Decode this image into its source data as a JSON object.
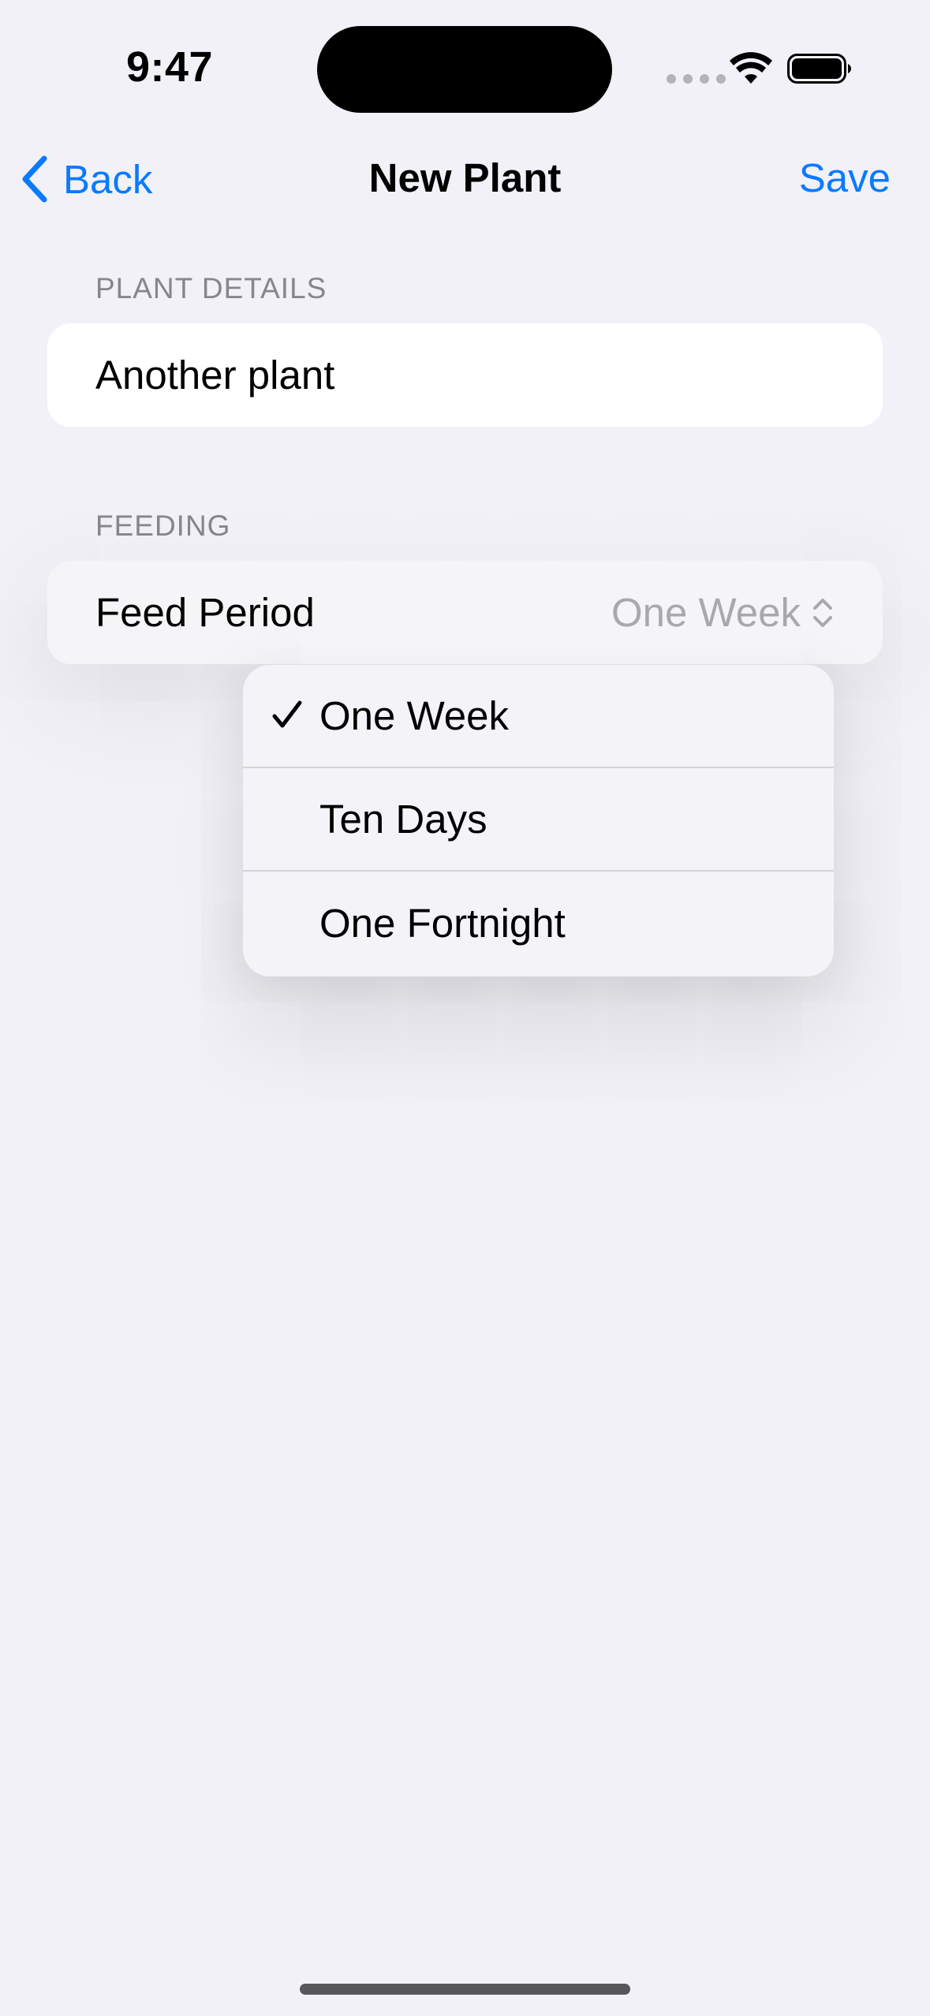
{
  "status_bar": {
    "time": "9:47"
  },
  "nav": {
    "back_label": "Back",
    "title": "New Plant",
    "save_label": "Save"
  },
  "sections": {
    "plant_details": {
      "header": "PLANT DETAILS",
      "name_value": "Another plant"
    },
    "feeding": {
      "header": "FEEDING",
      "feed_period_label": "Feed Period",
      "feed_period_value": "One Week"
    }
  },
  "menu": {
    "options": [
      {
        "label": "One Week",
        "selected": true
      },
      {
        "label": "Ten Days",
        "selected": false
      },
      {
        "label": "One Fortnight",
        "selected": false
      }
    ]
  },
  "colors": {
    "accent": "#0A7AFF",
    "background": "#F2F1F7",
    "secondary_text": "#86868B"
  }
}
